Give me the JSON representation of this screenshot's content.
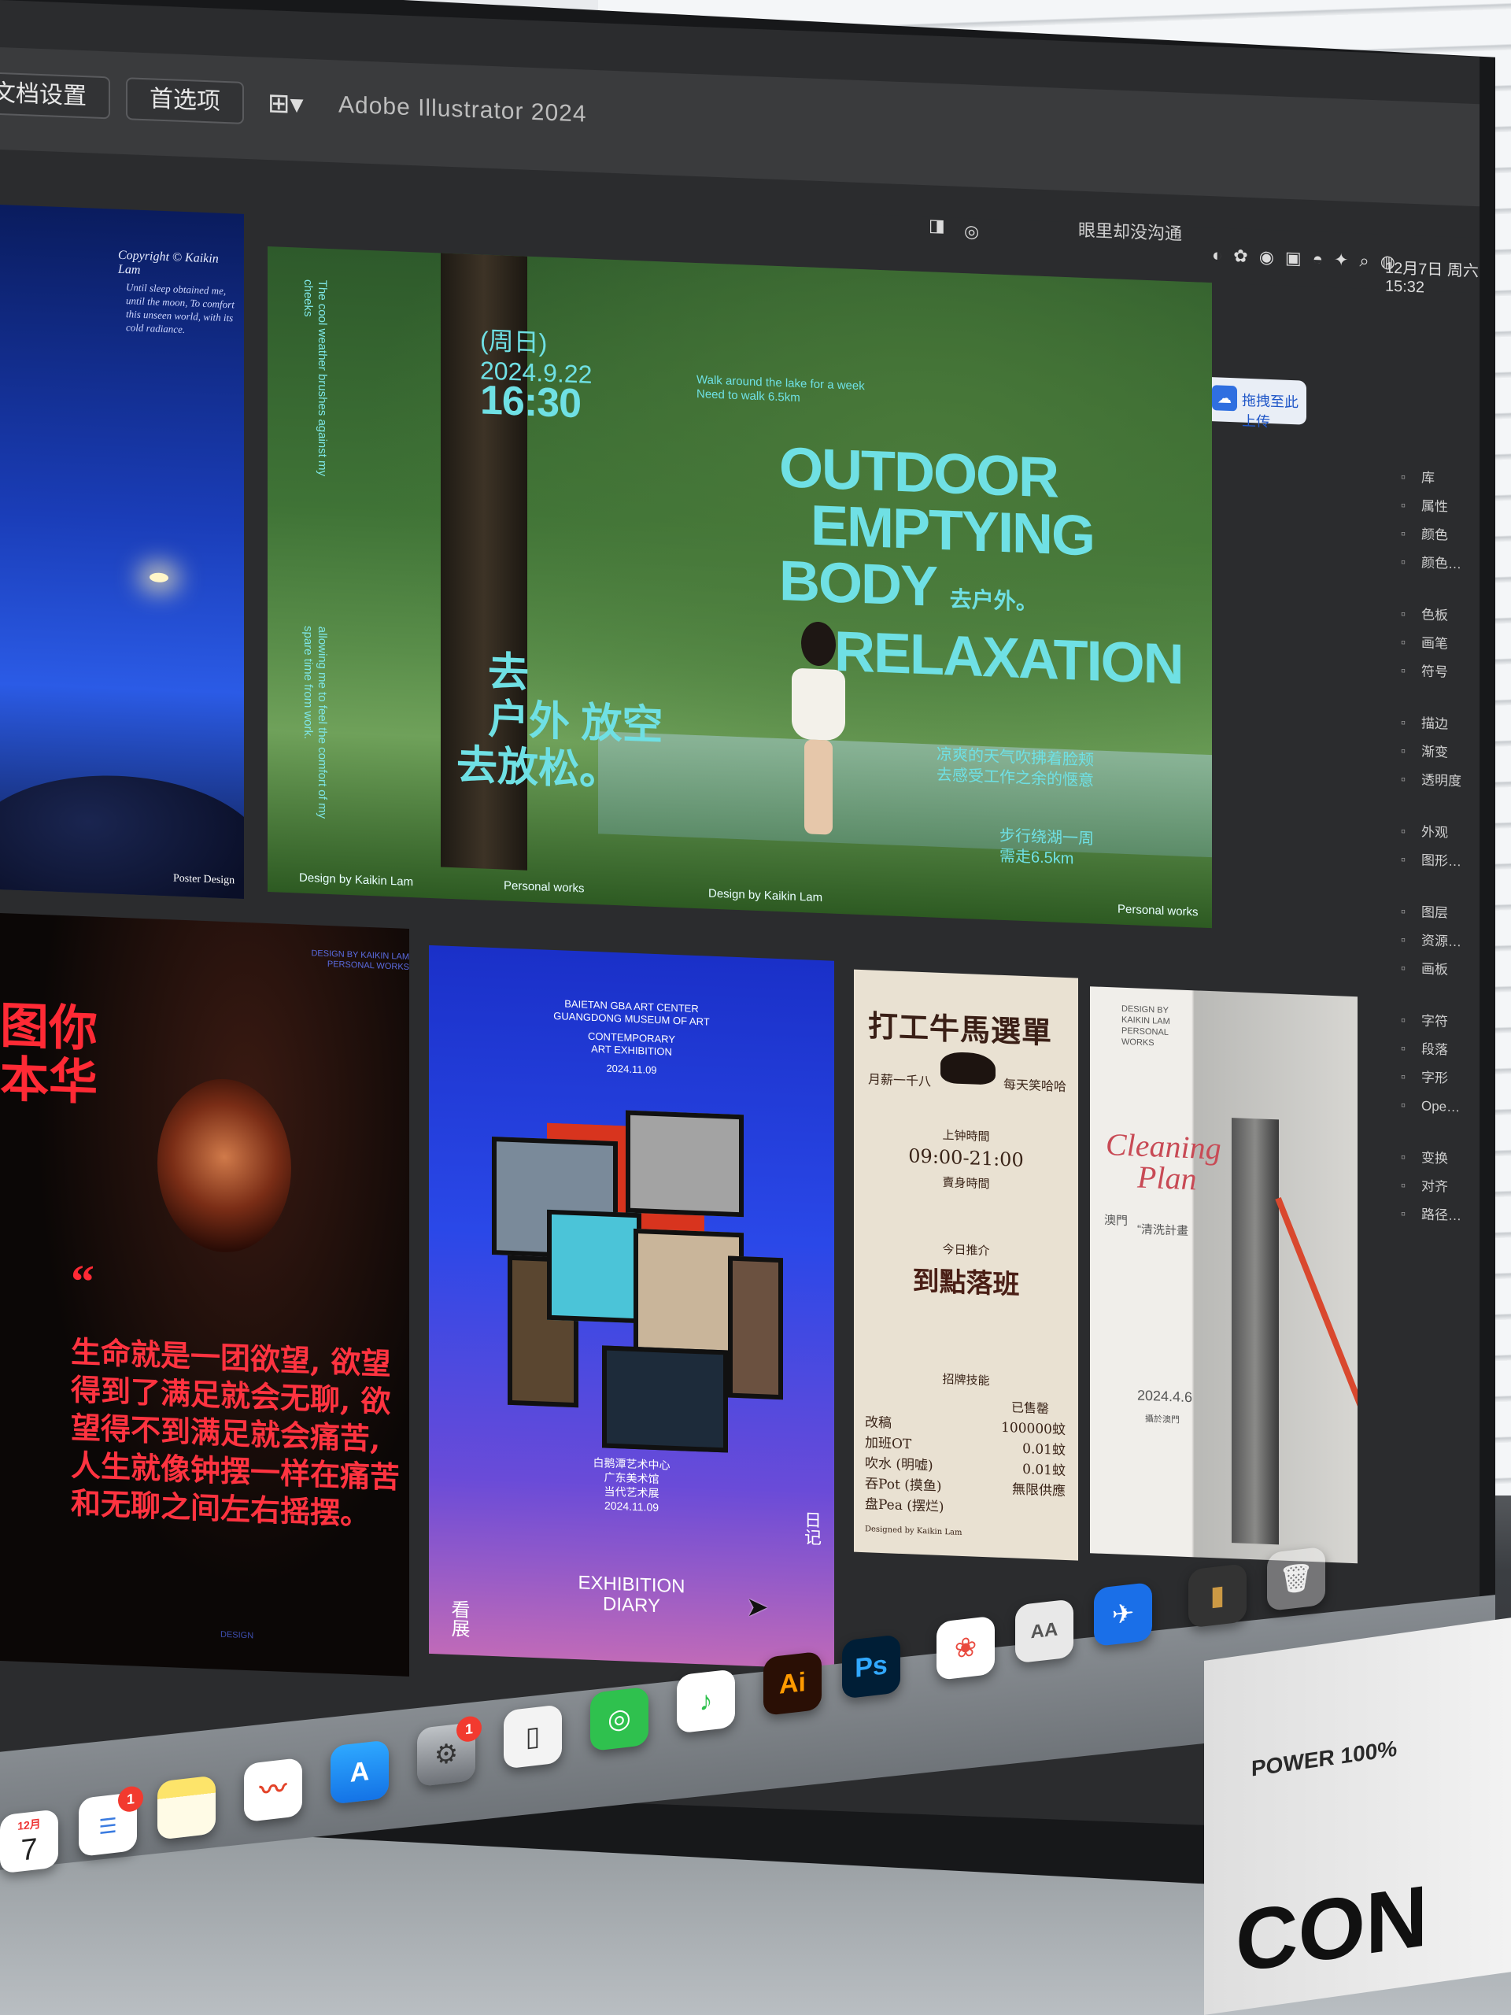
{
  "toolbar": {
    "doc_settings_label": "文档设置",
    "preferences_label": "首选项",
    "app_title": "Adobe Illustrator 2024"
  },
  "menubar": {
    "notice": "眼里却没沟通",
    "clock": "12月7日 周六 15:32"
  },
  "upload_button": {
    "label": "拖拽至此上传"
  },
  "right_panel": {
    "groups": [
      [
        "库",
        "属性",
        "颜色",
        "颜色…"
      ],
      [
        "色板",
        "画笔",
        "符号"
      ],
      [
        "描边",
        "渐变",
        "透明度"
      ],
      [
        "外观",
        "图形…"
      ],
      [
        "图层",
        "资源…",
        "画板"
      ],
      [
        "字符",
        "段落",
        "字形",
        "Ope…"
      ],
      [
        "变换",
        "对齐",
        "路径…"
      ]
    ]
  },
  "posters": {
    "night": {
      "copyright": "Copyright © Kaikin Lam",
      "verse": "Until sleep obtained me, until the moon, To comfort this unseen world, with its cold radiance.",
      "signature": "Poster Design"
    },
    "outdoor": {
      "vertical_en": "The cool weather brushes against my cheeks",
      "date_day": "(周日)",
      "date": "2024.9.22",
      "time": "16:30",
      "walk_line1": "Walk around the lake for a week",
      "walk_line2": "Need to walk 6.5km",
      "headline_line1": "OUTDOOR",
      "headline_line2": "EMPTYING",
      "headline_line3": "BODY",
      "headline_cn_small": "去户外。",
      "headline_line4": "RELAXATION",
      "vertical_en2": "allowing me to feel the comfort of my spare time from work.",
      "cn_line1": "去",
      "cn_line2": "户外 放空",
      "cn_line3": "去放松。",
      "cn_right1": "凉爽的天气吹拂着脸颊",
      "cn_right2": "去感受工作之余的惬意",
      "cn_walk1": "步行绕湖一周",
      "cn_walk2": "需走6.5km",
      "foot_design": "Design by Kaikin Lam",
      "foot_personal": "Personal works",
      "foot_design2": "Design by Kaikin Lam",
      "foot_personal2": "Personal works"
    },
    "red": {
      "header": "DESIGN BY KAIKIN LAM PERSONAL WORKS",
      "big_line1": "图你",
      "big_line2": "本华",
      "quote_mark": "“",
      "paragraph": "生命就是一团欲望, 欲望得到了满足就会无聊, 欲望得不到满足就会痛苦, 人生就像钟摆一样在痛苦和无聊之间左右摇摆。",
      "footer": "DESIGN"
    },
    "exhibition": {
      "header_line1": "BAIETAN GBA ART CENTER",
      "header_line2": "GUANGDONG MUSEUM OF ART",
      "header_line3": "CONTEMPORARY",
      "header_line4": "ART EXHIBITION",
      "header_date": "2024.11.09",
      "cn_line1": "白鹅潭艺术中心",
      "cn_line2": "广东美术馆",
      "cn_line3": "当代艺术展",
      "cn_date": "2024.11.09",
      "title_line1": "EXHIBITION",
      "title_line2": "DIARY",
      "side_left": "看展",
      "side_right": "日记"
    },
    "menu": {
      "title": "打工牛馬選單",
      "sub_left": "月薪一千八",
      "sub_right": "每天笑哈哈",
      "work_time_label": "上钟時間",
      "work_time": "09:00-21:00",
      "sell_time_label": "賣身時間",
      "today_label": "今日推介",
      "today_pick": "到點落班",
      "skills_label": "招牌技能",
      "sold_label": "已售罄",
      "rows": [
        {
          "item": "改稿",
          "price": "100000蚊"
        },
        {
          "item": "加班OT",
          "price": "0.01蚊"
        },
        {
          "item": "吹水 (明嘘)",
          "price": "0.01蚊"
        },
        {
          "item": "吞Pot (摸鱼)",
          "price": "無限供應"
        },
        {
          "item": "盘Pea (摆烂)",
          "price": ""
        }
      ],
      "footer": "Designed by Kaikin Lam"
    },
    "cleaning": {
      "header": "DESIGN BY KAIKIN LAM PERSONAL WORKS",
      "script_line1": "Cleaning",
      "script_line2": "Plan",
      "place": "澳門",
      "cn_title": "“清洗計畫",
      "date": "2024.4.6",
      "footer_cn": "攝於澳門"
    }
  },
  "dock": {
    "calendar_month": "12月",
    "calendar_day": "7",
    "reminders_badge": "1",
    "settings_badge": "1",
    "illustrator_label": "Ai",
    "photoshop_label": "Ps",
    "font_book_label": "AA"
  },
  "power_box": {
    "label": "POWER 100%",
    "brand": "CON"
  }
}
